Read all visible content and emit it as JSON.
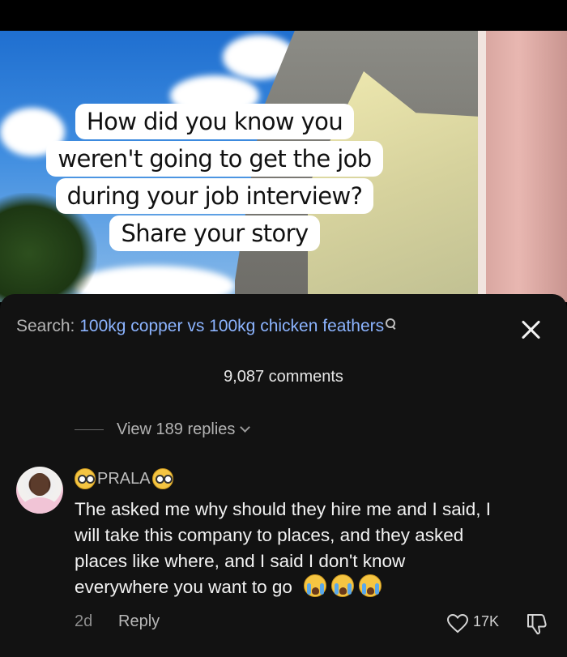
{
  "video": {
    "caption_lines": [
      "How did you know you",
      "weren't going to get the job",
      "during your job interview?",
      "Share your story"
    ]
  },
  "search": {
    "label": "Search:",
    "query": "100kg copper vs 100kg chicken feathers"
  },
  "comments": {
    "count_text": "9,087 comments",
    "view_replies": "View 189 replies",
    "comment": {
      "username": "PRALA",
      "text_lines": [
        "The asked me why should they hire me and I said, I",
        "will take this company to places, and they asked",
        "places like where, and I said I don't know",
        "everywhere you want to go"
      ],
      "age": "2d",
      "reply_label": "Reply",
      "likes": "17K"
    }
  },
  "icons": {
    "search": "search-icon",
    "close": "close-icon",
    "like": "heart-icon",
    "dislike": "thumbs-down-icon",
    "chevron": "chevron-down-icon"
  },
  "colors": {
    "sheet_bg": "#121212",
    "search_query": "#8cb4ff",
    "text_primary": "#f2f2f2",
    "text_secondary": "#8d8d8d"
  }
}
